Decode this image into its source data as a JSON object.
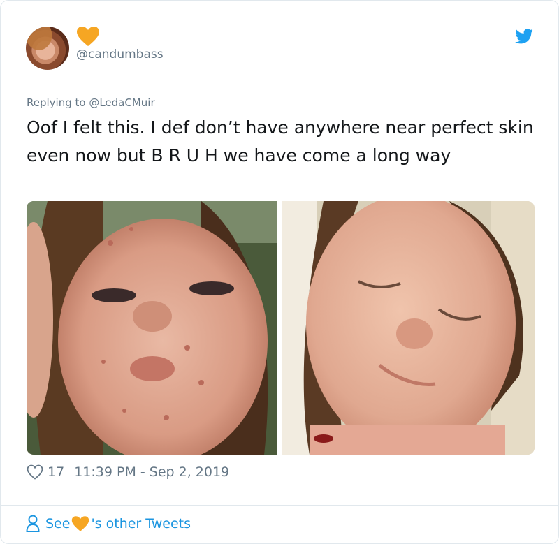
{
  "tweet": {
    "handle": "@candumbass",
    "replying_prefix": "Replying to ",
    "replying_to": "@LedaCMuir",
    "text": "Oof I felt this. I def don’t have anywhere near perfect skin even now but B R U H we have come a long way",
    "like_count": "17",
    "timestamp": "11:39 PM - Sep 2, 2019",
    "photos": [
      {
        "name": "before-photo"
      },
      {
        "name": "after-photo"
      }
    ]
  },
  "footer": {
    "see_label": "See",
    "other_tweets_label": "'s other Tweets"
  },
  "colors": {
    "heart_orange": "#f6a623",
    "twitter_blue": "#1da1f2",
    "link_blue": "#1b95e0",
    "muted_gray": "#657786"
  },
  "icons": [
    "heart-icon",
    "twitter-bird-icon",
    "like-icon",
    "person-icon"
  ]
}
